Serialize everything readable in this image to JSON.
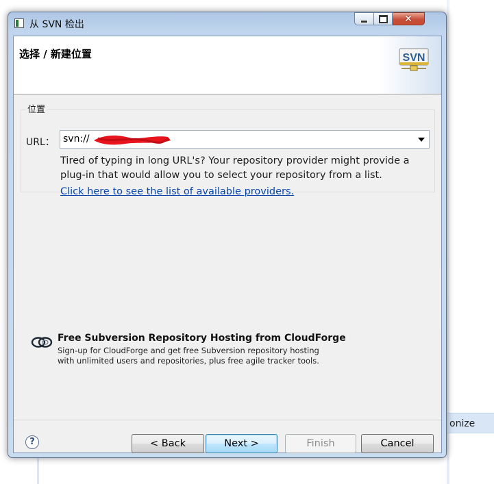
{
  "window": {
    "title": "从 SVN 检出",
    "minimize_label": "",
    "maximize_label": "",
    "close_label": "✕"
  },
  "header": {
    "title": "选择 / 新建位置",
    "logo_text": "SVN"
  },
  "location_group": {
    "label": "位置",
    "url_label": "URL：",
    "url_value": "svn://",
    "hint": "Tired of typing in long URL's?  Your repository provider might provide a plug-in that would allow you to select your repository from a list.",
    "link": "Click here to see the list of available providers."
  },
  "cloudforge": {
    "title": "Free Subversion Repository Hosting from CloudForge",
    "line1": "Sign-up for CloudForge and get free Subversion repository hosting",
    "line2": "with unlimited users and repositories, plus free agile tracker tools."
  },
  "footer": {
    "help": "?",
    "back": "< Back",
    "next": "Next >",
    "finish": "Finish",
    "cancel": "Cancel"
  },
  "background": {
    "item_text": "onize"
  },
  "colors": {
    "link": "#0645ad",
    "default_button": "#3c7fb1",
    "redaction": "#e8141e"
  }
}
